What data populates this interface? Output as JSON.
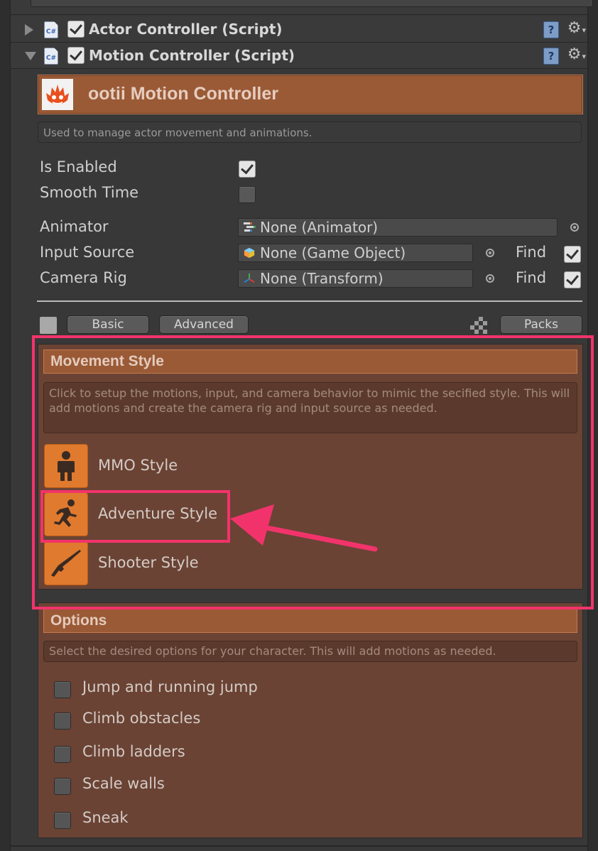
{
  "components": {
    "actor": {
      "title": "Actor Controller (Script)",
      "expanded": false,
      "enabled": true
    },
    "motion": {
      "title": "Motion Controller (Script)",
      "expanded": true,
      "enabled": true
    },
    "cs_icon": "C#",
    "help_icon": "?",
    "gear_icon": "⚙"
  },
  "banner": {
    "title": "ootii Motion Controller",
    "logo_icon": "ootii-logo-icon"
  },
  "description": "Used to manage actor movement and animations.",
  "fields": {
    "is_enabled": {
      "label": "Is Enabled",
      "checked": true
    },
    "smooth_time": {
      "label": "Smooth Time",
      "checked": false
    },
    "animator": {
      "label": "Animator",
      "value": "None (Animator)"
    },
    "input_source": {
      "label": "Input Source",
      "value": "None (Game Object)",
      "find_label": "Find",
      "find_checked": true
    },
    "camera_rig": {
      "label": "Camera Rig",
      "value": "None (Transform)",
      "find_label": "Find",
      "find_checked": true
    }
  },
  "tabs": {
    "basic": "Basic",
    "advanced": "Advanced",
    "packs": "Packs"
  },
  "movement_style": {
    "title": "Movement Style",
    "description": "Click to setup the motions, input, and camera behavior to mimic the secified style. This will add motions and create the camera rig and input source as needed.",
    "items": [
      {
        "label": "MMO Style",
        "icon": "person-icon"
      },
      {
        "label": "Adventure Style",
        "icon": "running-person-icon"
      },
      {
        "label": "Shooter Style",
        "icon": "rifle-icon"
      }
    ]
  },
  "options": {
    "title": "Options",
    "description": "Select the desired options for your character. This will add motions as needed.",
    "items": [
      {
        "label": "Jump and running jump",
        "checked": false
      },
      {
        "label": "Climb obstacles",
        "checked": false
      },
      {
        "label": "Climb ladders",
        "checked": false
      },
      {
        "label": "Scale walls",
        "checked": false
      },
      {
        "label": "Sneak",
        "checked": false
      }
    ]
  },
  "colors": {
    "highlight": "#f2336b",
    "section_bg": "#6a4334",
    "header_orange": "#9a5a36",
    "icon_orange": "#e07a2e"
  }
}
